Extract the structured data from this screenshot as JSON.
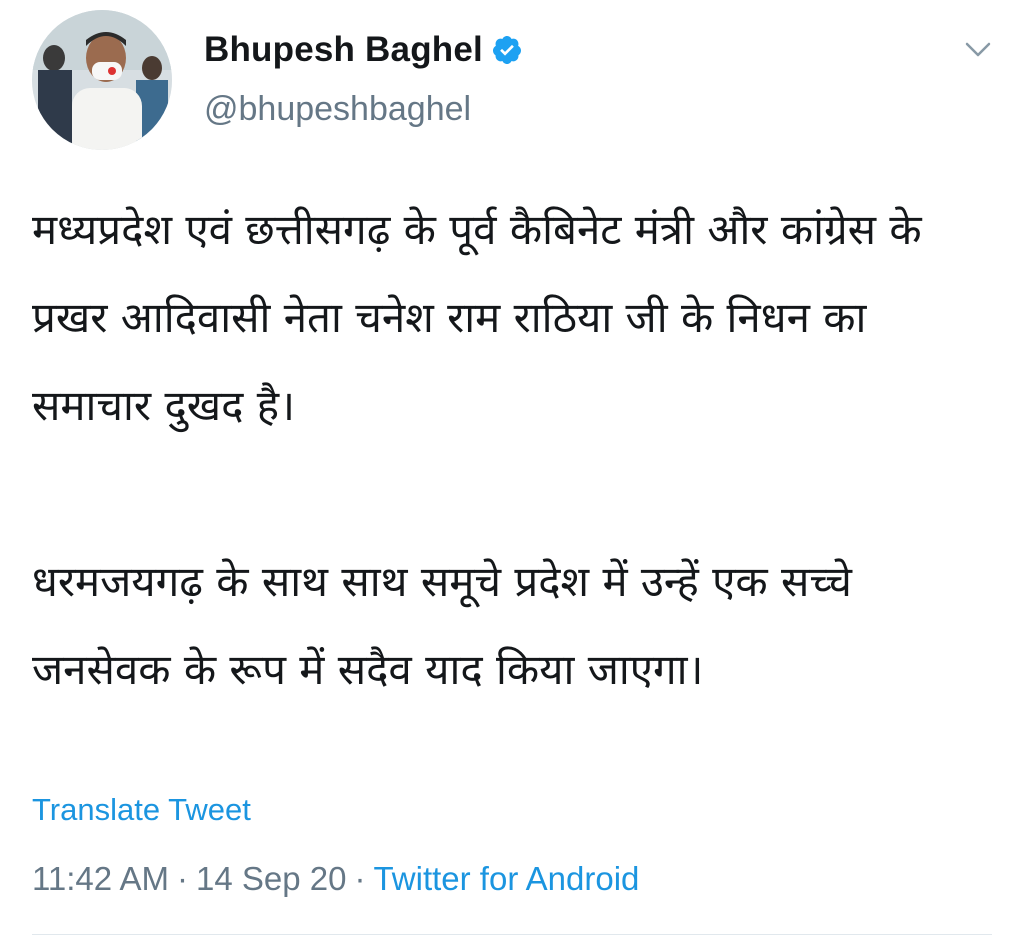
{
  "tweet": {
    "author": {
      "display_name": "Bhupesh Baghel",
      "handle": "@bhupeshbaghel",
      "verified": true,
      "avatar_icon": "profile-photo"
    },
    "paragraphs": [
      "मध्यप्रदेश एवं छत्तीसगढ़ के पूर्व कैबिनेट मंत्री और कांग्रेस के प्रखर आदिवासी नेता चनेश राम राठिया जी के निधन का समाचार दुखद है।",
      "धरमजयगढ़ के साथ साथ समूचे प्रदेश में उन्हें एक सच्चे जनसेवक के रूप में सदैव याद किया जाएगा।"
    ],
    "translate_label": "Translate Tweet",
    "time": "11:42 AM",
    "date": "14 Sep 20",
    "separator": "·",
    "source": "Twitter for Android"
  },
  "icons": {
    "menu": "chevron-down-icon",
    "verified": "verified-badge-icon"
  },
  "colors": {
    "link": "#1b95e0",
    "verified": "#1da1f2",
    "secondary_text": "#657786",
    "primary_text": "#14171a"
  }
}
